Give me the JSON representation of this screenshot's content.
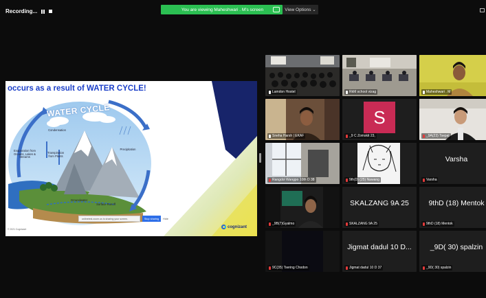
{
  "topbar": {
    "recording_label": "Recording...",
    "banner_text": "You are viewing Maheshwari . M's screen",
    "view_options_label": "View Options ⌄"
  },
  "slide": {
    "heading": "occurs as a result of WATER CYCLE!",
    "cycle_title": "WATER CYCLE",
    "labels": {
      "condensation": "Condensation",
      "evaporation": "Evaporation from Oceans, Lakes & Streams",
      "transpiration": "Transpiration from Plants",
      "precipitation": "Precipitation",
      "groundwater": "Groundwater",
      "runoff": "Surface Runoff"
    },
    "share_bar_text": "onlinetest.zoom.us is sharing your screen.",
    "stop_sharing_label": "Stop sharing",
    "hide_label": "Hide",
    "copyright": "© 2021 Cognizant",
    "brand": "cognizant"
  },
  "participants": [
    {
      "name": "Lamdon Hostel",
      "mic": "on"
    },
    {
      "name": "RkM  school vizag",
      "mic": "on"
    },
    {
      "name": "Maheshwari . M",
      "mic": "on"
    },
    {
      "name": "Sneha Harsh | EKAF",
      "mic": "on"
    },
    {
      "name": "_9 C Zomskit 23,",
      "mic": "off",
      "avatar": "S"
    },
    {
      "name": "_9A(23) Tsepal",
      "mic": "off"
    },
    {
      "name": "Rangdol Wangpo 10th D 38",
      "mic": "off"
    },
    {
      "name": "9th(D) (25) Nawang",
      "mic": "off"
    },
    {
      "name": "Varsha",
      "mic": "off",
      "display": "Varsha"
    },
    {
      "name": "_9B(7)Gyalmo",
      "mic": "off"
    },
    {
      "name": "SKALZANG 9A 25",
      "mic": "off",
      "display": "SKALZANG 9A 25"
    },
    {
      "name": "9thD (18) Mentok",
      "mic": "off",
      "display": "9thD (18) Mentok"
    },
    {
      "name": "9C(35) Tsering Chodon",
      "mic": "off"
    },
    {
      "name": "Jigmat dadul 10 D 37",
      "mic": "off",
      "display": "Jigmat dadul 10 D..."
    },
    {
      "name": "_9D( 30) spalzin",
      "mic": "off",
      "display": "_9D( 30) spalzin"
    }
  ],
  "colors": {
    "active_speaker": "#2fcf5a",
    "banner": "#2bbf52",
    "slide_heading": "#1a3ec8",
    "muted_mic": "#e23a3a"
  }
}
